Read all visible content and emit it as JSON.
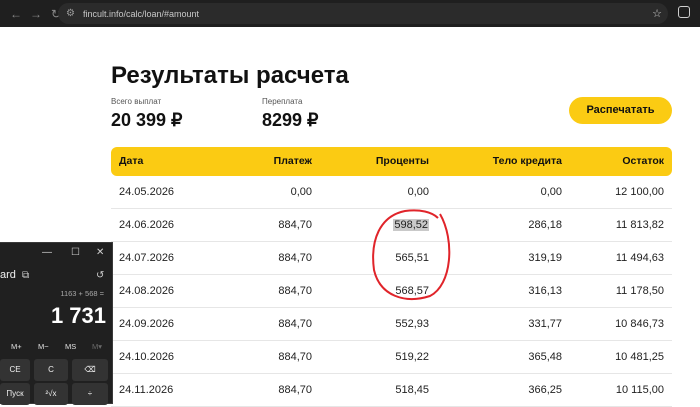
{
  "browser": {
    "url": "fincult.info/calc/loan/#amount"
  },
  "page": {
    "title": "Результаты расчета",
    "total_label": "Всего выплат",
    "total_value": "20 399 ₽",
    "overpay_label": "Переплата",
    "overpay_value": "8299 ₽",
    "print_label": "Распечатать"
  },
  "table": {
    "headers": {
      "date": "Дата",
      "payment": "Платеж",
      "interest": "Проценты",
      "body": "Тело кредита",
      "balance": "Остаток"
    },
    "rows": [
      {
        "date": "24.05.2026",
        "payment": "0,00",
        "interest": "0,00",
        "body": "0,00",
        "balance": "12 100,00"
      },
      {
        "date": "24.06.2026",
        "payment": "884,70",
        "interest": "598,52",
        "body": "286,18",
        "balance": "11 813,82"
      },
      {
        "date": "24.07.2026",
        "payment": "884,70",
        "interest": "565,51",
        "body": "319,19",
        "balance": "11 494,63"
      },
      {
        "date": "24.08.2026",
        "payment": "884,70",
        "interest": "568,57",
        "body": "316,13",
        "balance": "11 178,50"
      },
      {
        "date": "24.09.2026",
        "payment": "884,70",
        "interest": "552,93",
        "body": "331,77",
        "balance": "10 846,73"
      },
      {
        "date": "24.10.2026",
        "payment": "884,70",
        "interest": "519,22",
        "body": "365,48",
        "balance": "10 481,25"
      },
      {
        "date": "24.11.2026",
        "payment": "884,70",
        "interest": "518,45",
        "body": "366,25",
        "balance": "10 115,00"
      }
    ]
  },
  "calculator": {
    "mode": "ard",
    "expression": "1163 + 568 =",
    "display": "1 731",
    "memory": [
      "M+",
      "M−",
      "MS",
      "M▾"
    ],
    "keys": [
      "CE",
      "C",
      "⌫",
      "Пуск",
      "²√x",
      "÷"
    ]
  },
  "colors": {
    "accent": "#fbcb13",
    "annotation": "#e0242a"
  }
}
